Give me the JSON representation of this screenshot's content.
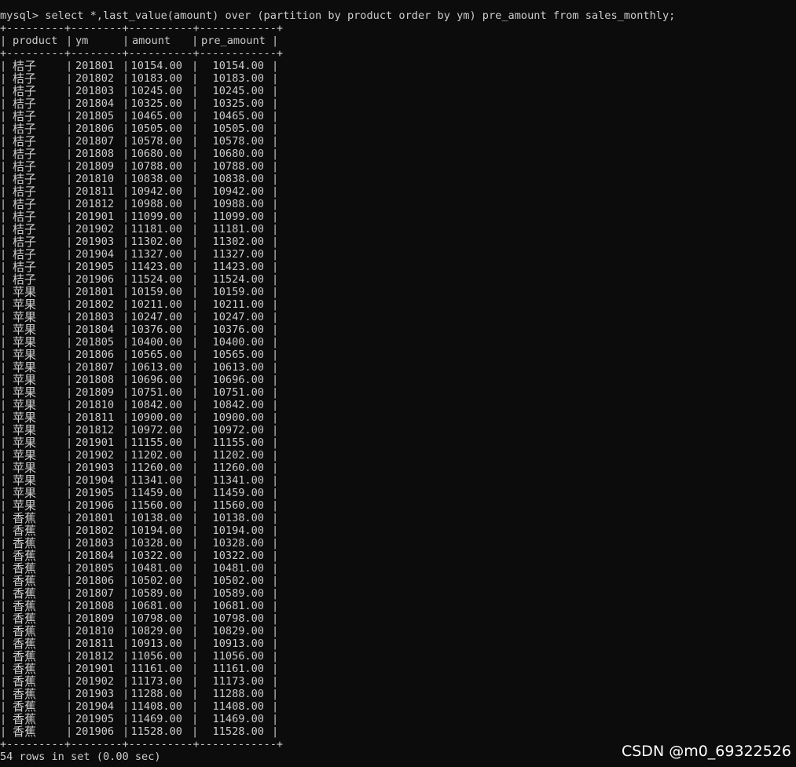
{
  "prompt_line": "mysql> select *,last_value(amount) over (partition by product order by ym) pre_amount from sales_monthly;",
  "separator": "+---------+--------+----------+------------+",
  "columns": [
    "product",
    "ym",
    "amount",
    "pre_amount"
  ],
  "rows": [
    [
      "桔子",
      "201801",
      "10154.00",
      "10154.00"
    ],
    [
      "桔子",
      "201802",
      "10183.00",
      "10183.00"
    ],
    [
      "桔子",
      "201803",
      "10245.00",
      "10245.00"
    ],
    [
      "桔子",
      "201804",
      "10325.00",
      "10325.00"
    ],
    [
      "桔子",
      "201805",
      "10465.00",
      "10465.00"
    ],
    [
      "桔子",
      "201806",
      "10505.00",
      "10505.00"
    ],
    [
      "桔子",
      "201807",
      "10578.00",
      "10578.00"
    ],
    [
      "桔子",
      "201808",
      "10680.00",
      "10680.00"
    ],
    [
      "桔子",
      "201809",
      "10788.00",
      "10788.00"
    ],
    [
      "桔子",
      "201810",
      "10838.00",
      "10838.00"
    ],
    [
      "桔子",
      "201811",
      "10942.00",
      "10942.00"
    ],
    [
      "桔子",
      "201812",
      "10988.00",
      "10988.00"
    ],
    [
      "桔子",
      "201901",
      "11099.00",
      "11099.00"
    ],
    [
      "桔子",
      "201902",
      "11181.00",
      "11181.00"
    ],
    [
      "桔子",
      "201903",
      "11302.00",
      "11302.00"
    ],
    [
      "桔子",
      "201904",
      "11327.00",
      "11327.00"
    ],
    [
      "桔子",
      "201905",
      "11423.00",
      "11423.00"
    ],
    [
      "桔子",
      "201906",
      "11524.00",
      "11524.00"
    ],
    [
      "苹果",
      "201801",
      "10159.00",
      "10159.00"
    ],
    [
      "苹果",
      "201802",
      "10211.00",
      "10211.00"
    ],
    [
      "苹果",
      "201803",
      "10247.00",
      "10247.00"
    ],
    [
      "苹果",
      "201804",
      "10376.00",
      "10376.00"
    ],
    [
      "苹果",
      "201805",
      "10400.00",
      "10400.00"
    ],
    [
      "苹果",
      "201806",
      "10565.00",
      "10565.00"
    ],
    [
      "苹果",
      "201807",
      "10613.00",
      "10613.00"
    ],
    [
      "苹果",
      "201808",
      "10696.00",
      "10696.00"
    ],
    [
      "苹果",
      "201809",
      "10751.00",
      "10751.00"
    ],
    [
      "苹果",
      "201810",
      "10842.00",
      "10842.00"
    ],
    [
      "苹果",
      "201811",
      "10900.00",
      "10900.00"
    ],
    [
      "苹果",
      "201812",
      "10972.00",
      "10972.00"
    ],
    [
      "苹果",
      "201901",
      "11155.00",
      "11155.00"
    ],
    [
      "苹果",
      "201902",
      "11202.00",
      "11202.00"
    ],
    [
      "苹果",
      "201903",
      "11260.00",
      "11260.00"
    ],
    [
      "苹果",
      "201904",
      "11341.00",
      "11341.00"
    ],
    [
      "苹果",
      "201905",
      "11459.00",
      "11459.00"
    ],
    [
      "苹果",
      "201906",
      "11560.00",
      "11560.00"
    ],
    [
      "香蕉",
      "201801",
      "10138.00",
      "10138.00"
    ],
    [
      "香蕉",
      "201802",
      "10194.00",
      "10194.00"
    ],
    [
      "香蕉",
      "201803",
      "10328.00",
      "10328.00"
    ],
    [
      "香蕉",
      "201804",
      "10322.00",
      "10322.00"
    ],
    [
      "香蕉",
      "201805",
      "10481.00",
      "10481.00"
    ],
    [
      "香蕉",
      "201806",
      "10502.00",
      "10502.00"
    ],
    [
      "香蕉",
      "201807",
      "10589.00",
      "10589.00"
    ],
    [
      "香蕉",
      "201808",
      "10681.00",
      "10681.00"
    ],
    [
      "香蕉",
      "201809",
      "10798.00",
      "10798.00"
    ],
    [
      "香蕉",
      "201810",
      "10829.00",
      "10829.00"
    ],
    [
      "香蕉",
      "201811",
      "10913.00",
      "10913.00"
    ],
    [
      "香蕉",
      "201812",
      "11056.00",
      "11056.00"
    ],
    [
      "香蕉",
      "201901",
      "11161.00",
      "11161.00"
    ],
    [
      "香蕉",
      "201902",
      "11173.00",
      "11173.00"
    ],
    [
      "香蕉",
      "201903",
      "11288.00",
      "11288.00"
    ],
    [
      "香蕉",
      "201904",
      "11408.00",
      "11408.00"
    ],
    [
      "香蕉",
      "201905",
      "11469.00",
      "11469.00"
    ],
    [
      "香蕉",
      "201906",
      "11528.00",
      "11528.00"
    ]
  ],
  "footer": "54 rows in set (0.00 sec)",
  "watermark": "CSDN @m0_69322526",
  "colors": {
    "background": "#0c0c0c",
    "text": "#cccccc",
    "watermark": "#ffffff"
  }
}
